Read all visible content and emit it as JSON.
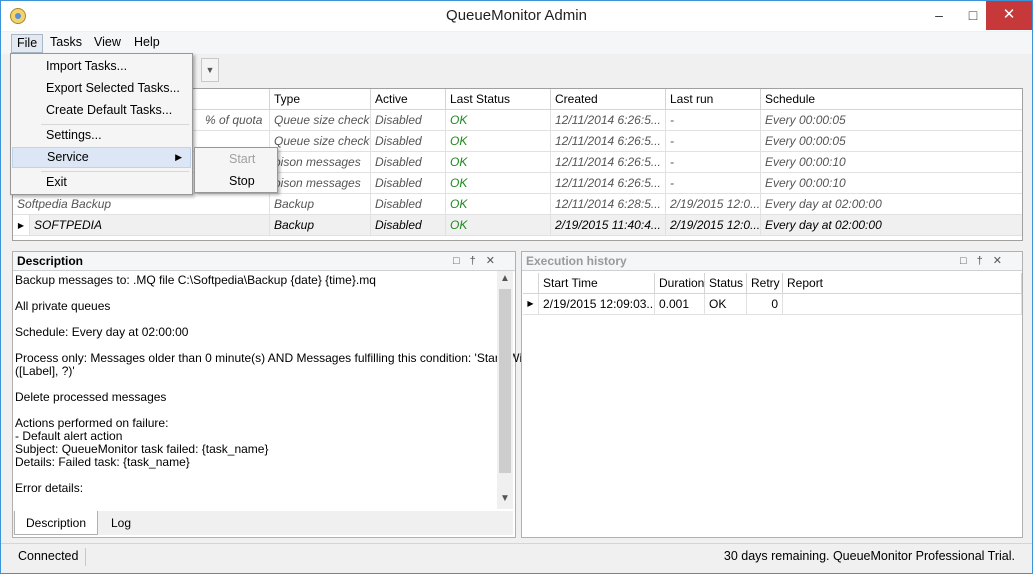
{
  "window": {
    "title": "QueueMonitor Admin"
  },
  "menubar": {
    "file": "File",
    "tasks": "Tasks",
    "view": "View",
    "help": "Help"
  },
  "file_menu": {
    "items": [
      "Import Tasks...",
      "Export Selected Tasks...",
      "Create Default Tasks...",
      "Settings...",
      "Service",
      "Exit"
    ]
  },
  "service_submenu": {
    "start": "Start",
    "stop": "Stop"
  },
  "tasks_grid": {
    "columns": [
      "Type",
      "Active",
      "Last Status",
      "Created",
      "Last run",
      "Schedule"
    ],
    "rows": [
      {
        "name": "% of quota",
        "type": "Queue size check",
        "active": "Disabled",
        "status": "OK",
        "created": "12/11/2014 6:26:5...",
        "last_run": "-",
        "schedule": "Every 00:00:05"
      },
      {
        "name": "",
        "type": "Queue size check",
        "active": "Disabled",
        "status": "OK",
        "created": "12/11/2014 6:26:5...",
        "last_run": "-",
        "schedule": "Every 00:00:05"
      },
      {
        "name": "",
        "type": "oison messages",
        "active": "Disabled",
        "status": "OK",
        "created": "12/11/2014 6:26:5...",
        "last_run": "-",
        "schedule": "Every 00:00:10"
      },
      {
        "name": "",
        "type": "oison messages",
        "active": "Disabled",
        "status": "OK",
        "created": "12/11/2014 6:26:5...",
        "last_run": "-",
        "schedule": "Every 00:00:10"
      },
      {
        "name": "Softpedia Backup",
        "type": "Backup",
        "active": "Disabled",
        "status": "OK",
        "created": "12/11/2014 6:28:5...",
        "last_run": "2/19/2015 12:0...",
        "schedule": "Every day at 02:00:00"
      },
      {
        "name": "SOFTPEDIA",
        "type": "Backup",
        "active": "Disabled",
        "status": "OK",
        "created": "2/19/2015 11:40:4...",
        "last_run": "2/19/2015 12:0...",
        "schedule": "Every day at 02:00:00"
      }
    ]
  },
  "description_panel": {
    "title": "Description",
    "lines": [
      "Backup messages to: .MQ file C:\\Softpedia\\Backup {date} {time}.mq",
      "All private queues",
      "Schedule: Every day at 02:00:00",
      "Process only: Messages older than 0 minute(s) AND Messages fulfilling this condition: 'StartsWith",
      "([Label], ?)'",
      "Delete processed messages",
      "Actions performed on failure:",
      "- Default alert action",
      "Subject: QueueMonitor task failed: {task_name}",
      "Details: Failed task: {task_name}",
      "Error details:"
    ],
    "tabs": [
      "Description",
      "Log"
    ]
  },
  "history_panel": {
    "title": "Execution history",
    "columns": [
      "Start Time",
      "Duration",
      "Status",
      "Retry",
      "Report"
    ],
    "rows": [
      {
        "start": "2/19/2015 12:09:03...",
        "duration": "0.001",
        "status": "OK",
        "retry": "0",
        "report": ""
      }
    ]
  },
  "statusbar": {
    "left": "Connected",
    "right": "30 days remaining. QueueMonitor Professional Trial."
  },
  "icons": {
    "close": "close-icon",
    "maximize": "maximize-icon",
    "minimize": "minimize-icon"
  }
}
